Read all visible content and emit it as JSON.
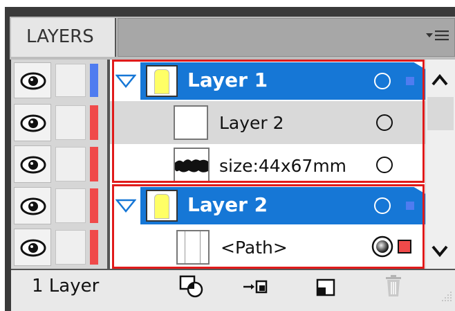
{
  "panel": {
    "tab_label": "LAYERS",
    "menu_icon": "panel-menu-icon",
    "footer_count": "1 Layer"
  },
  "layers": [
    {
      "name": "Layer 1",
      "type": "layer",
      "expanded": true,
      "selected": true,
      "color": "#4f7cf0"
    },
    {
      "name": "Layer 2",
      "type": "sublayer",
      "selected": false,
      "color": "#f04a4a"
    },
    {
      "name": "size:44x67mm",
      "type": "item",
      "selected": false,
      "color": "#f04a4a"
    },
    {
      "name": "Layer 2",
      "type": "layer",
      "expanded": true,
      "selected": true,
      "color": "#f04a4a"
    },
    {
      "name": "<Path>",
      "type": "item",
      "selected": false,
      "targeted": true,
      "color": "#f04a4a"
    }
  ],
  "footer": {
    "buttons": [
      "make-clipping-mask-icon",
      "create-sublayer-icon",
      "create-new-layer-icon",
      "trash-icon"
    ]
  },
  "colors": {
    "selection_blue": "#1677d6",
    "highlight_red": "#e01a1a",
    "layer1_color": "#4f7cf0",
    "layer2_color": "#f04a4a"
  }
}
